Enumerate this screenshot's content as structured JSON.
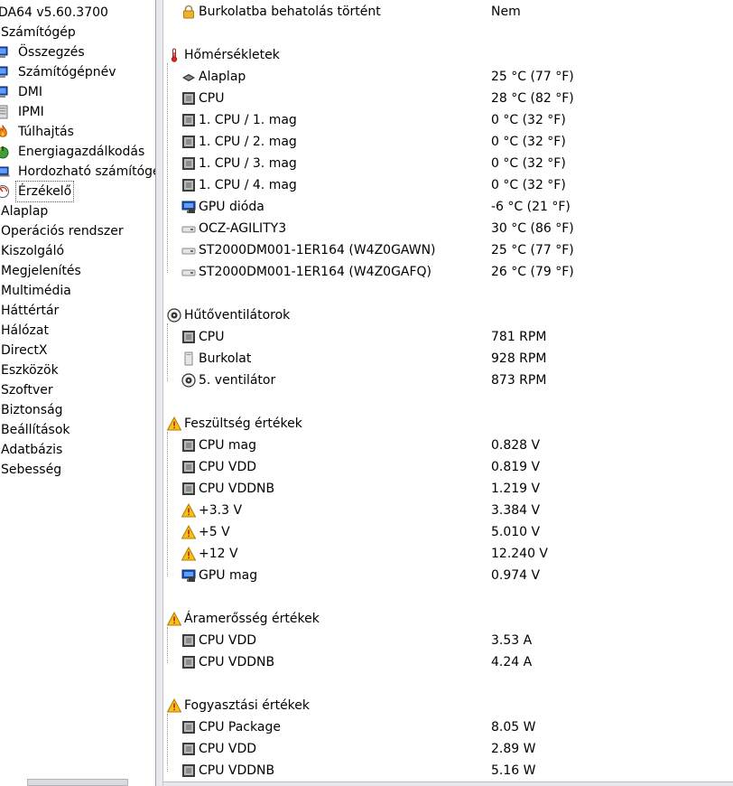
{
  "sidebar": {
    "app_title": "DA64 v5.60.3700",
    "items": [
      {
        "label": "Számítógép",
        "icon": "none"
      },
      {
        "label": "Összegzés",
        "icon": "computer-icon"
      },
      {
        "label": "Számítógépnév",
        "icon": "computer-icon"
      },
      {
        "label": "DMI",
        "icon": "computer-icon"
      },
      {
        "label": "IPMI",
        "icon": "server-icon"
      },
      {
        "label": "Túlhajtás",
        "icon": "flame-icon"
      },
      {
        "label": "Energiagazdálkodás",
        "icon": "power-icon"
      },
      {
        "label": "Hordozható számítógép",
        "icon": "laptop-icon"
      },
      {
        "label": "Érzékelő",
        "icon": "sensor-icon",
        "selected": true
      },
      {
        "label": "Alaplap",
        "icon": "none"
      },
      {
        "label": "Operációs rendszer",
        "icon": "none"
      },
      {
        "label": "Kiszolgáló",
        "icon": "none"
      },
      {
        "label": "Megjelenítés",
        "icon": "none"
      },
      {
        "label": "Multimédia",
        "icon": "none"
      },
      {
        "label": "Háttértár",
        "icon": "none"
      },
      {
        "label": "Hálózat",
        "icon": "none"
      },
      {
        "label": "DirectX",
        "icon": "none"
      },
      {
        "label": "Eszközök",
        "icon": "none"
      },
      {
        "label": "Szoftver",
        "icon": "none"
      },
      {
        "label": "Biztonság",
        "icon": "none"
      },
      {
        "label": "Beállítások",
        "icon": "none"
      },
      {
        "label": "Adatbázis",
        "icon": "none"
      },
      {
        "label": "Sebesség",
        "icon": "none"
      }
    ]
  },
  "main": {
    "top_row": {
      "label": "Burkolatba behatolás történt",
      "value": "Nem",
      "icon": "lock-icon"
    },
    "sections": [
      {
        "title": "Hőmérsékletek",
        "icon": "thermometer-icon",
        "rows": [
          {
            "label": "Alaplap",
            "value": "25 °C  (77 °F)",
            "icon": "motherboard-icon"
          },
          {
            "label": "CPU",
            "value": "28 °C  (82 °F)",
            "icon": "chip-icon"
          },
          {
            "label": "1. CPU / 1. mag",
            "value": "0 °C  (32 °F)",
            "icon": "chip-icon"
          },
          {
            "label": "1. CPU / 2. mag",
            "value": "0 °C  (32 °F)",
            "icon": "chip-icon"
          },
          {
            "label": "1. CPU / 3. mag",
            "value": "0 °C  (32 °F)",
            "icon": "chip-icon"
          },
          {
            "label": "1. CPU / 4. mag",
            "value": "0 °C  (32 °F)",
            "icon": "chip-icon"
          },
          {
            "label": "GPU dióda",
            "value": "-6 °C  (21 °F)",
            "icon": "gpu-icon"
          },
          {
            "label": "OCZ-AGILITY3",
            "value": "30 °C  (86 °F)",
            "icon": "drive-icon"
          },
          {
            "label": "ST2000DM001-1ER164 (W4Z0GAWN)",
            "value": "25 °C  (77 °F)",
            "icon": "drive-icon"
          },
          {
            "label": "ST2000DM001-1ER164 (W4Z0GAFQ)",
            "value": "26 °C  (79 °F)",
            "icon": "drive-icon"
          }
        ]
      },
      {
        "title": "Hűtőventilátorok",
        "icon": "fan-icon",
        "rows": [
          {
            "label": "CPU",
            "value": "781 RPM",
            "icon": "chip-icon"
          },
          {
            "label": "Burkolat",
            "value": "928 RPM",
            "icon": "case-icon"
          },
          {
            "label": "5. ventilátor",
            "value": "873 RPM",
            "icon": "fan-icon"
          }
        ]
      },
      {
        "title": "Feszültség értékek",
        "icon": "warning-icon",
        "rows": [
          {
            "label": "CPU mag",
            "value": "0.828 V",
            "icon": "chip-icon"
          },
          {
            "label": "CPU VDD",
            "value": "0.819 V",
            "icon": "chip-icon"
          },
          {
            "label": "CPU VDDNB",
            "value": "1.219 V",
            "icon": "chip-icon"
          },
          {
            "label": "+3.3 V",
            "value": "3.384 V",
            "icon": "warning-icon"
          },
          {
            "label": "+5 V",
            "value": "5.010 V",
            "icon": "warning-icon"
          },
          {
            "label": "+12 V",
            "value": "12.240 V",
            "icon": "warning-icon"
          },
          {
            "label": "GPU mag",
            "value": "0.974 V",
            "icon": "gpu-icon"
          }
        ]
      },
      {
        "title": "Áramerősség értékek",
        "icon": "warning-icon",
        "rows": [
          {
            "label": "CPU VDD",
            "value": "3.53 A",
            "icon": "chip-icon"
          },
          {
            "label": "CPU VDDNB",
            "value": "4.24 A",
            "icon": "chip-icon"
          }
        ]
      },
      {
        "title": "Fogyasztási értékek",
        "icon": "warning-icon",
        "rows": [
          {
            "label": "CPU Package",
            "value": "8.05 W",
            "icon": "chip-icon"
          },
          {
            "label": "CPU VDD",
            "value": "2.89 W",
            "icon": "chip-icon"
          },
          {
            "label": "CPU VDDNB",
            "value": "5.16 W",
            "icon": "chip-icon"
          }
        ]
      }
    ]
  }
}
